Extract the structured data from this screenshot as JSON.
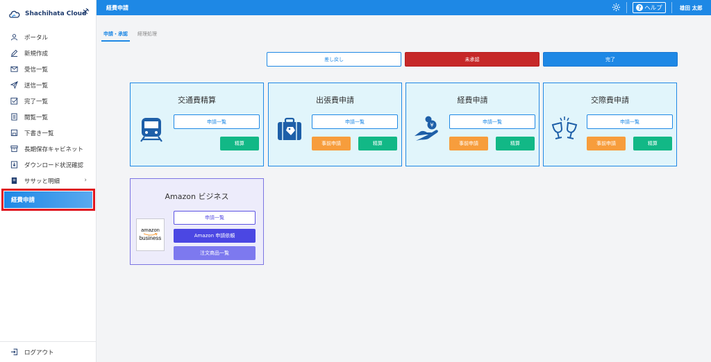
{
  "brand": {
    "name": "Shachihata Cloud"
  },
  "sidebar": {
    "items": [
      {
        "label": "ポータル"
      },
      {
        "label": "新規作成"
      },
      {
        "label": "受信一覧"
      },
      {
        "label": "送信一覧"
      },
      {
        "label": "完了一覧"
      },
      {
        "label": "閲覧一覧"
      },
      {
        "label": "下書き一覧"
      },
      {
        "label": "長期保存キャビネット"
      },
      {
        "label": "ダウンロード状況確認"
      },
      {
        "label": "ササッと明細"
      },
      {
        "label": "経費申請"
      }
    ],
    "logout_label": "ログアウト"
  },
  "header": {
    "title": "経費申請",
    "help_label": "ヘルプ",
    "user_name": "雄田 太郎"
  },
  "tabs": [
    {
      "label": "申請・承認"
    },
    {
      "label": "経理処理"
    }
  ],
  "filters": [
    {
      "label": "差し戻し"
    },
    {
      "label": "未承認"
    },
    {
      "label": "完了"
    }
  ],
  "cards": [
    {
      "title": "交通費精算",
      "list_label": "申請一覧",
      "settle_label": "精算"
    },
    {
      "title": "出張費申請",
      "list_label": "申請一覧",
      "pre_label": "事前申請",
      "settle_label": "精算"
    },
    {
      "title": "経費申請",
      "list_label": "申請一覧",
      "pre_label": "事前申請",
      "settle_label": "精算"
    },
    {
      "title": "交際費申請",
      "list_label": "申請一覧",
      "pre_label": "事前申請",
      "settle_label": "精算"
    }
  ],
  "amazon": {
    "title": "Amazon ビジネス",
    "logo_line1": "amazon",
    "logo_line2": "business",
    "list_label": "申請一覧",
    "request_label": "Amazon 申請依頼",
    "orders_label": "注文商品一覧"
  },
  "colors": {
    "primary": "#1e88e5",
    "danger": "#c62828",
    "settle": "#12b886",
    "pre": "#f79d3c",
    "amazon_accent": "#4b47e3"
  }
}
